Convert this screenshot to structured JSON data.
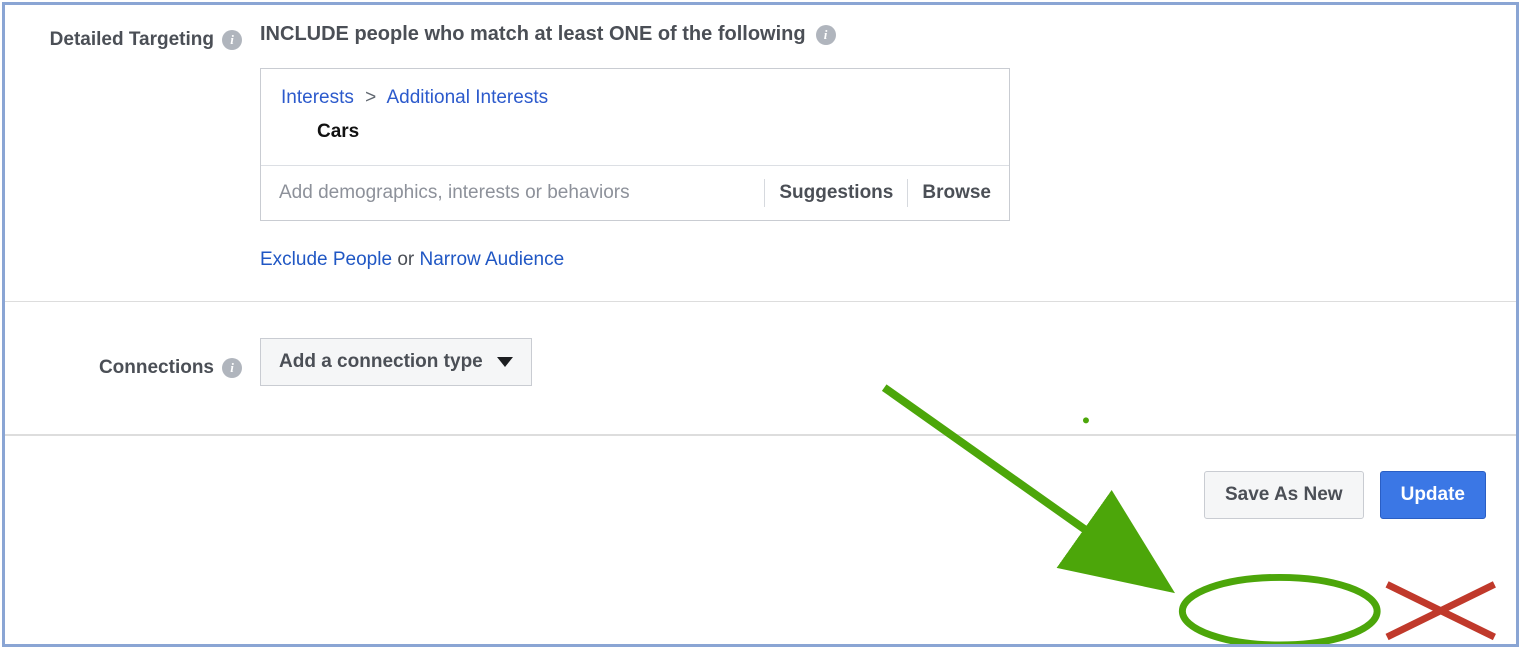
{
  "detailed_targeting": {
    "label": "Detailed Targeting",
    "include_text": "INCLUDE people who match at least ONE of the following",
    "breadcrumb": {
      "interests": "Interests",
      "separator": ">",
      "additional": "Additional Interests"
    },
    "selected": "Cars",
    "input_placeholder": "Add demographics, interests or behaviors",
    "suggestions_label": "Suggestions",
    "browse_label": "Browse",
    "exclude_label": "Exclude People",
    "or_text": " or ",
    "narrow_label": "Narrow Audience"
  },
  "connections": {
    "label": "Connections",
    "button_label": "Add a connection type"
  },
  "footer": {
    "save_as_new": "Save As New",
    "update": "Update"
  },
  "info_glyph": "i"
}
